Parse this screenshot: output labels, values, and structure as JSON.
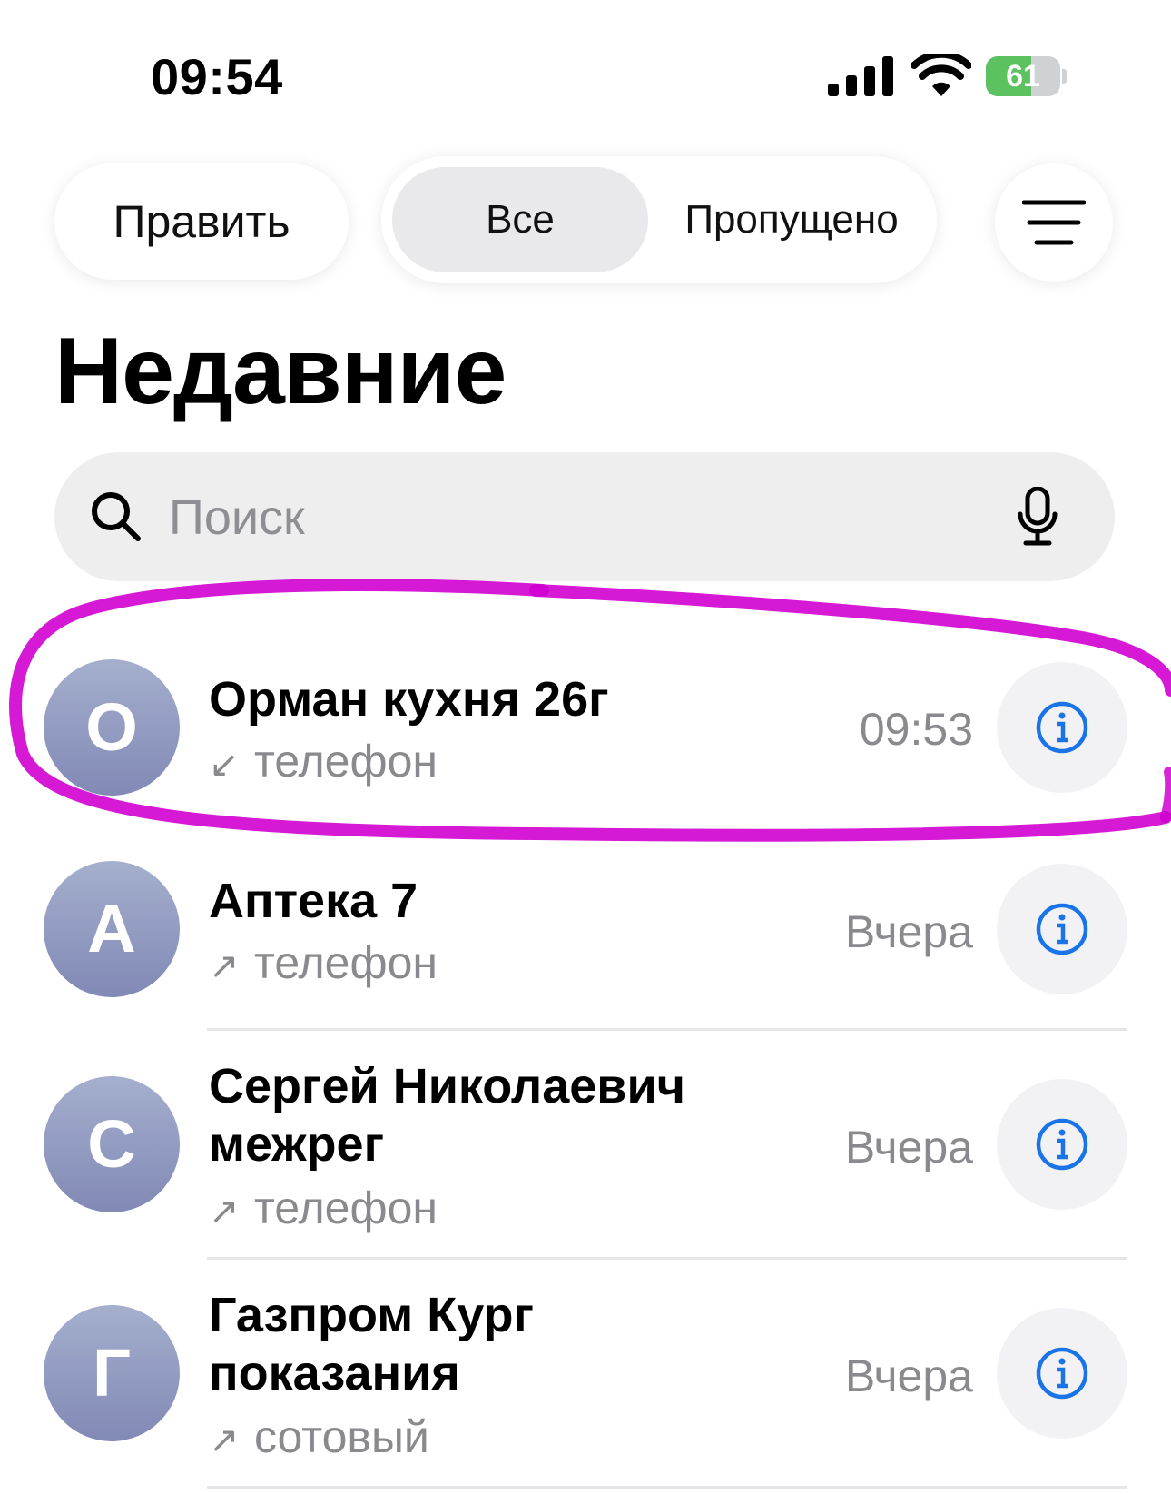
{
  "status_bar": {
    "time": "09:54",
    "battery_percent": "61",
    "battery_level": 0.61,
    "icons": [
      "signal-icon",
      "wifi-icon",
      "battery-charging-icon"
    ]
  },
  "header": {
    "edit_label": "Править",
    "segments": [
      "Все",
      "Пропущено"
    ],
    "selected_segment": "Все",
    "filter_icon": "filter-lines-icon"
  },
  "title": "Недавние",
  "search": {
    "placeholder": "Поиск",
    "value": "",
    "icons": [
      "search-icon",
      "microphone-icon"
    ]
  },
  "calls": [
    {
      "initial": "О",
      "name": "Орман кухня 26г",
      "direction": "↙",
      "type": "телефон",
      "time": "09:53",
      "highlighted": true
    },
    {
      "initial": "А",
      "name": "Аптека 7",
      "direction": "↗",
      "type": "телефон",
      "time": "Вчера"
    },
    {
      "initial": "С",
      "name": "Сергей Николаевич межрег",
      "direction": "↗",
      "type": "телефон",
      "time": "Вчера"
    },
    {
      "initial": "Г",
      "name": "Газпром Кург показания",
      "direction": "↗",
      "type": "сотовый",
      "time": "Вчера"
    }
  ],
  "colors": {
    "accent": "#1a74e8",
    "highlight": "#d000d0",
    "battery": "#5bc25f",
    "avatar_gradient": [
      "#a5afcd",
      "#8189b5"
    ]
  }
}
